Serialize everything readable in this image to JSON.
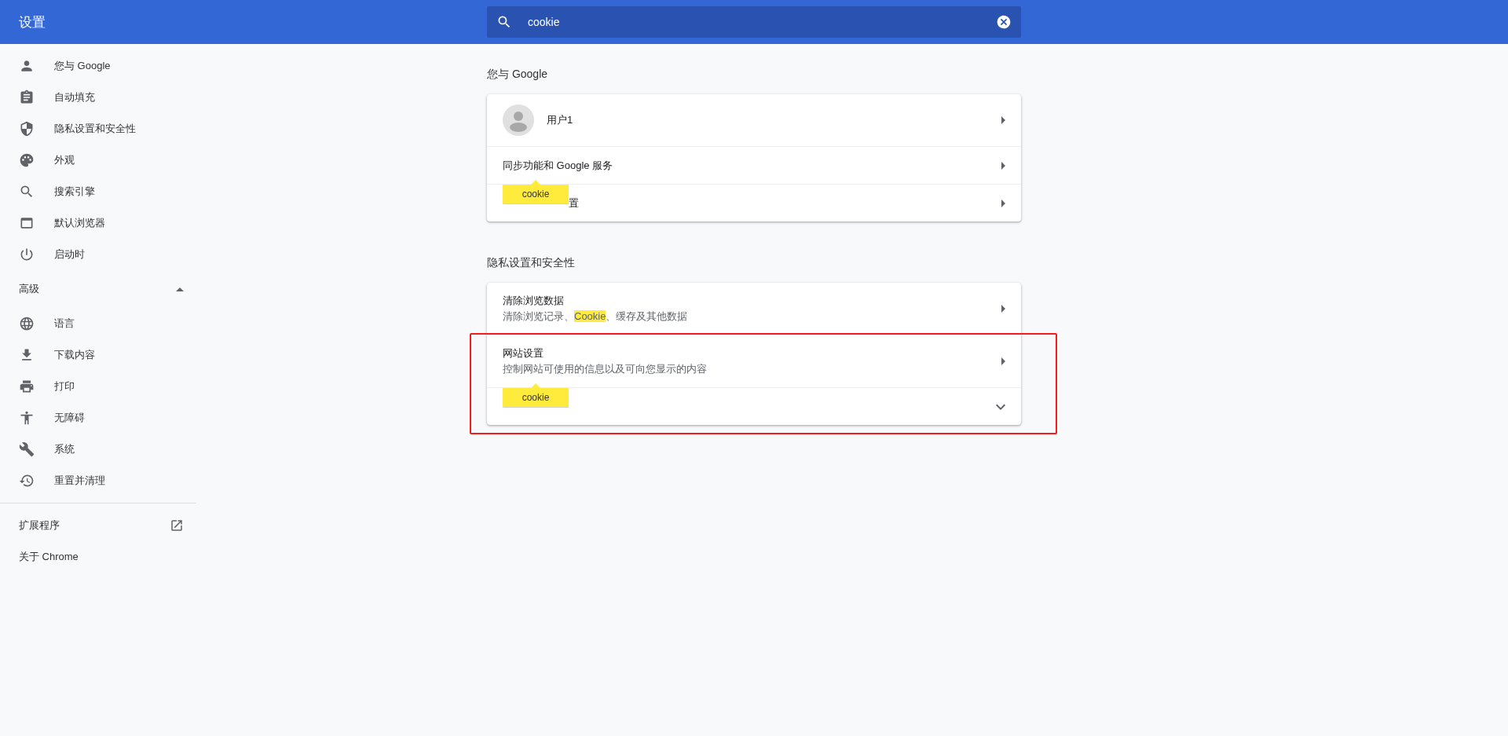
{
  "header": {
    "title": "设置"
  },
  "search": {
    "value": "cookie"
  },
  "sidebar": {
    "items": [
      {
        "label": "您与 Google"
      },
      {
        "label": "自动填充"
      },
      {
        "label": "隐私设置和安全性"
      },
      {
        "label": "外观"
      },
      {
        "label": "搜索引擎"
      },
      {
        "label": "默认浏览器"
      },
      {
        "label": "启动时"
      }
    ],
    "advanced": {
      "label": "高级",
      "expanded": true,
      "items": [
        {
          "label": "语言"
        },
        {
          "label": "下载内容"
        },
        {
          "label": "打印"
        },
        {
          "label": "无障碍"
        },
        {
          "label": "系统"
        },
        {
          "label": "重置并清理"
        }
      ]
    },
    "footer_items": [
      {
        "label": "扩展程序",
        "external": true
      },
      {
        "label": "关于 Chrome",
        "external": false
      }
    ]
  },
  "sections": [
    {
      "title": "您与 Google",
      "rows": [
        {
          "kind": "profile",
          "label": "用户1",
          "expandable": false,
          "framed": false
        },
        {
          "kind": "plain",
          "label": "同步功能和 Google 服务",
          "expandable": false,
          "framed": false
        },
        {
          "kind": "covered",
          "label": "置",
          "expandable": false,
          "framed": false,
          "search_bubble": "cookie"
        }
      ]
    },
    {
      "title": "隐私设置和安全性",
      "rows": [
        {
          "kind": "detail",
          "label": "清除浏览数据",
          "subtitle": [
            {
              "text": "清除浏览记录、",
              "highlighted": false
            },
            {
              "text": "Cookie",
              "highlighted": true
            },
            {
              "text": "、缓存及其他数据",
              "highlighted": false
            }
          ],
          "expandable": false,
          "framed": false
        },
        {
          "kind": "detail",
          "label": "网站设置",
          "subtitle": [
            {
              "text": "控制网站可使用的信息以及可向您显示的内容",
              "highlighted": false
            }
          ],
          "expandable": false,
          "framed": true
        },
        {
          "kind": "covered",
          "expandable": true,
          "framed": true,
          "search_bubble": "cookie"
        }
      ]
    }
  ]
}
